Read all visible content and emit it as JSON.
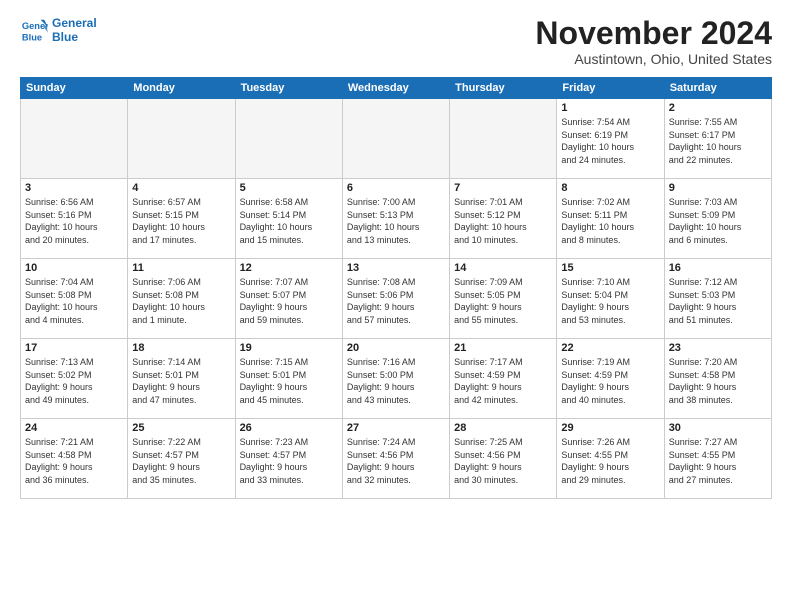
{
  "header": {
    "logo_line1": "General",
    "logo_line2": "Blue",
    "month_title": "November 2024",
    "location": "Austintown, Ohio, United States"
  },
  "weekdays": [
    "Sunday",
    "Monday",
    "Tuesday",
    "Wednesday",
    "Thursday",
    "Friday",
    "Saturday"
  ],
  "weeks": [
    [
      {
        "day": "",
        "info": ""
      },
      {
        "day": "",
        "info": ""
      },
      {
        "day": "",
        "info": ""
      },
      {
        "day": "",
        "info": ""
      },
      {
        "day": "",
        "info": ""
      },
      {
        "day": "1",
        "info": "Sunrise: 7:54 AM\nSunset: 6:19 PM\nDaylight: 10 hours\nand 24 minutes."
      },
      {
        "day": "2",
        "info": "Sunrise: 7:55 AM\nSunset: 6:17 PM\nDaylight: 10 hours\nand 22 minutes."
      }
    ],
    [
      {
        "day": "3",
        "info": "Sunrise: 6:56 AM\nSunset: 5:16 PM\nDaylight: 10 hours\nand 20 minutes."
      },
      {
        "day": "4",
        "info": "Sunrise: 6:57 AM\nSunset: 5:15 PM\nDaylight: 10 hours\nand 17 minutes."
      },
      {
        "day": "5",
        "info": "Sunrise: 6:58 AM\nSunset: 5:14 PM\nDaylight: 10 hours\nand 15 minutes."
      },
      {
        "day": "6",
        "info": "Sunrise: 7:00 AM\nSunset: 5:13 PM\nDaylight: 10 hours\nand 13 minutes."
      },
      {
        "day": "7",
        "info": "Sunrise: 7:01 AM\nSunset: 5:12 PM\nDaylight: 10 hours\nand 10 minutes."
      },
      {
        "day": "8",
        "info": "Sunrise: 7:02 AM\nSunset: 5:11 PM\nDaylight: 10 hours\nand 8 minutes."
      },
      {
        "day": "9",
        "info": "Sunrise: 7:03 AM\nSunset: 5:09 PM\nDaylight: 10 hours\nand 6 minutes."
      }
    ],
    [
      {
        "day": "10",
        "info": "Sunrise: 7:04 AM\nSunset: 5:08 PM\nDaylight: 10 hours\nand 4 minutes."
      },
      {
        "day": "11",
        "info": "Sunrise: 7:06 AM\nSunset: 5:08 PM\nDaylight: 10 hours\nand 1 minute."
      },
      {
        "day": "12",
        "info": "Sunrise: 7:07 AM\nSunset: 5:07 PM\nDaylight: 9 hours\nand 59 minutes."
      },
      {
        "day": "13",
        "info": "Sunrise: 7:08 AM\nSunset: 5:06 PM\nDaylight: 9 hours\nand 57 minutes."
      },
      {
        "day": "14",
        "info": "Sunrise: 7:09 AM\nSunset: 5:05 PM\nDaylight: 9 hours\nand 55 minutes."
      },
      {
        "day": "15",
        "info": "Sunrise: 7:10 AM\nSunset: 5:04 PM\nDaylight: 9 hours\nand 53 minutes."
      },
      {
        "day": "16",
        "info": "Sunrise: 7:12 AM\nSunset: 5:03 PM\nDaylight: 9 hours\nand 51 minutes."
      }
    ],
    [
      {
        "day": "17",
        "info": "Sunrise: 7:13 AM\nSunset: 5:02 PM\nDaylight: 9 hours\nand 49 minutes."
      },
      {
        "day": "18",
        "info": "Sunrise: 7:14 AM\nSunset: 5:01 PM\nDaylight: 9 hours\nand 47 minutes."
      },
      {
        "day": "19",
        "info": "Sunrise: 7:15 AM\nSunset: 5:01 PM\nDaylight: 9 hours\nand 45 minutes."
      },
      {
        "day": "20",
        "info": "Sunrise: 7:16 AM\nSunset: 5:00 PM\nDaylight: 9 hours\nand 43 minutes."
      },
      {
        "day": "21",
        "info": "Sunrise: 7:17 AM\nSunset: 4:59 PM\nDaylight: 9 hours\nand 42 minutes."
      },
      {
        "day": "22",
        "info": "Sunrise: 7:19 AM\nSunset: 4:59 PM\nDaylight: 9 hours\nand 40 minutes."
      },
      {
        "day": "23",
        "info": "Sunrise: 7:20 AM\nSunset: 4:58 PM\nDaylight: 9 hours\nand 38 minutes."
      }
    ],
    [
      {
        "day": "24",
        "info": "Sunrise: 7:21 AM\nSunset: 4:58 PM\nDaylight: 9 hours\nand 36 minutes."
      },
      {
        "day": "25",
        "info": "Sunrise: 7:22 AM\nSunset: 4:57 PM\nDaylight: 9 hours\nand 35 minutes."
      },
      {
        "day": "26",
        "info": "Sunrise: 7:23 AM\nSunset: 4:57 PM\nDaylight: 9 hours\nand 33 minutes."
      },
      {
        "day": "27",
        "info": "Sunrise: 7:24 AM\nSunset: 4:56 PM\nDaylight: 9 hours\nand 32 minutes."
      },
      {
        "day": "28",
        "info": "Sunrise: 7:25 AM\nSunset: 4:56 PM\nDaylight: 9 hours\nand 30 minutes."
      },
      {
        "day": "29",
        "info": "Sunrise: 7:26 AM\nSunset: 4:55 PM\nDaylight: 9 hours\nand 29 minutes."
      },
      {
        "day": "30",
        "info": "Sunrise: 7:27 AM\nSunset: 4:55 PM\nDaylight: 9 hours\nand 27 minutes."
      }
    ]
  ]
}
